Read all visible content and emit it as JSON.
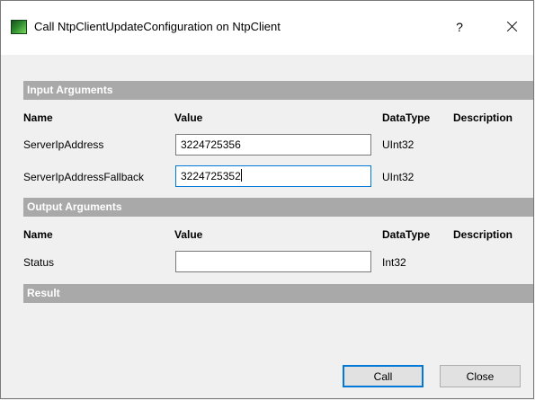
{
  "window": {
    "title": "Call NtpClientUpdateConfiguration on NtpClient",
    "help_glyph": "?",
    "icon": "green-app-icon"
  },
  "input_section": {
    "title": "Input Arguments",
    "headers": {
      "name": "Name",
      "value": "Value",
      "datatype": "DataType",
      "description": "Description"
    },
    "rows": [
      {
        "name": "ServerIpAddress",
        "value": "3224725356",
        "datatype": "UInt32"
      },
      {
        "name": "ServerIpAddressFallback",
        "value": "3224725352",
        "datatype": "UInt32"
      }
    ]
  },
  "output_section": {
    "title": "Output Arguments",
    "headers": {
      "name": "Name",
      "value": "Value",
      "datatype": "DataType",
      "description": "Description"
    },
    "rows": [
      {
        "name": "Status",
        "value": "",
        "datatype": "Int32"
      }
    ]
  },
  "result_section": {
    "title": "Result"
  },
  "buttons": {
    "call": "Call",
    "close": "Close"
  }
}
